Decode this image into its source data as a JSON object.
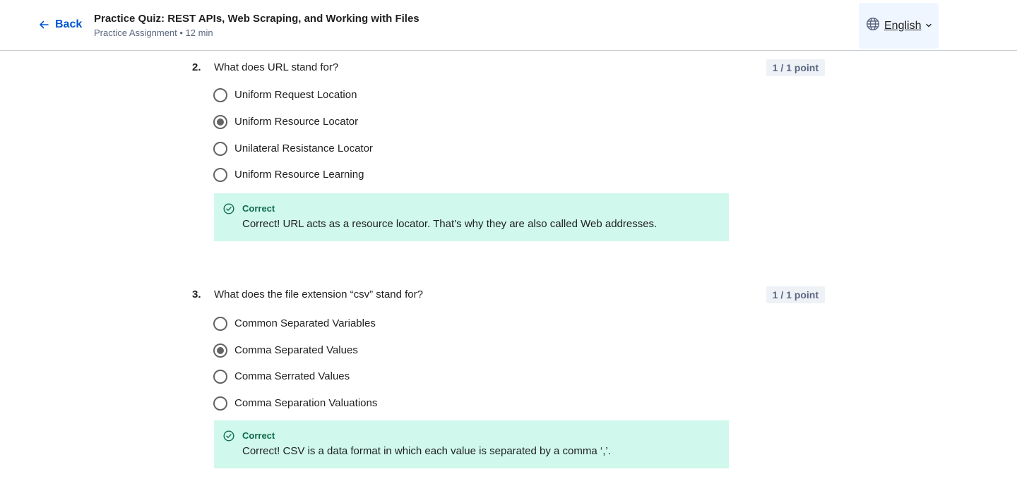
{
  "header": {
    "back_label": "Back",
    "title": "Practice Quiz: REST APIs, Web Scraping, and Working with Files",
    "subtitle": "Practice Assignment • 12 min",
    "language": "English"
  },
  "questions": [
    {
      "number": "2.",
      "text": "What does URL stand for?",
      "points": "1 / 1 point",
      "options": [
        {
          "label": "Uniform Request Location",
          "selected": false
        },
        {
          "label": "Uniform Resource Locator",
          "selected": true
        },
        {
          "label": "Unilateral Resistance Locator",
          "selected": false
        },
        {
          "label": "Uniform Resource Learning",
          "selected": false
        }
      ],
      "feedback": {
        "status": "Correct",
        "text": "Correct! URL acts as a resource locator. That’s why they are also called Web addresses."
      }
    },
    {
      "number": "3.",
      "text": "What does the file extension “csv” stand for?",
      "points": "1 / 1 point",
      "options": [
        {
          "label": "Common Separated Variables",
          "selected": false
        },
        {
          "label": "Comma Separated Values",
          "selected": true
        },
        {
          "label": "Comma Serrated Values",
          "selected": false
        },
        {
          "label": "Comma Separation Valuations",
          "selected": false
        }
      ],
      "feedback": {
        "status": "Correct",
        "text": "Correct! CSV is a data format in which each value is separated by a comma ‘,’."
      }
    }
  ]
}
